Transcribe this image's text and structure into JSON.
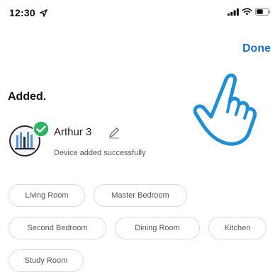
{
  "status_bar": {
    "time": "12:30",
    "icons": [
      "location-arrow-icon",
      "signal-icon",
      "wifi-icon",
      "battery-icon"
    ]
  },
  "header": {
    "done_label": "Done"
  },
  "main": {
    "title": "Added.",
    "device": {
      "name": "Arthur 3",
      "status": "Device added successfully"
    },
    "rooms": [
      "Living Room",
      "Master Bedroom",
      "Second Bedroom",
      "Dining Room",
      "Kitchen",
      "Study Room"
    ]
  },
  "colors": {
    "accent": "#1a73c8",
    "success": "#2fb463",
    "hand": "#1f8fd8"
  }
}
